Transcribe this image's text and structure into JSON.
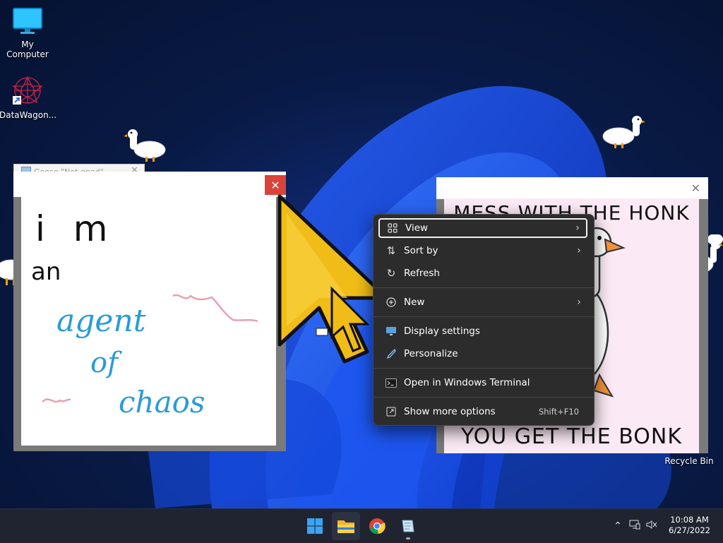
{
  "desktop": {
    "icons": [
      {
        "label": "My Computer",
        "icon": "monitor-icon"
      },
      {
        "label": "DataWagon...",
        "icon": "datawagon-icon"
      },
      {
        "label": "Recycle Bin",
        "icon": "recycle-bin-icon"
      }
    ]
  },
  "notepad_window": {
    "title": "Goose \"Not-epad\"",
    "note_lines": [
      "i m",
      "an",
      "agent",
      "of",
      "chaos"
    ]
  },
  "meme_window": {
    "top_text": "MESS WITH THE HONK",
    "bottom_text": "YOU GET THE BONK"
  },
  "context_menu": {
    "items": [
      {
        "label": "View",
        "icon": "grid-icon",
        "submenu": true
      },
      {
        "label": "Sort by",
        "icon": "sort-icon",
        "submenu": true
      },
      {
        "label": "Refresh",
        "icon": "refresh-icon",
        "submenu": false
      },
      {
        "label": "New",
        "icon": "plus-circle-icon",
        "submenu": true
      },
      {
        "label": "Display settings",
        "icon": "display-icon",
        "submenu": false
      },
      {
        "label": "Personalize",
        "icon": "brush-icon",
        "submenu": false
      },
      {
        "label": "Open in Windows Terminal",
        "icon": "terminal-icon",
        "submenu": false
      },
      {
        "label": "Show more options",
        "icon": "expand-icon",
        "shortcut": "Shift+F10"
      }
    ]
  },
  "taskbar": {
    "apps": [
      {
        "name": "Start",
        "icon": "windows-start-icon"
      },
      {
        "name": "File Explorer",
        "icon": "folder-icon"
      },
      {
        "name": "Google Chrome",
        "icon": "chrome-icon"
      },
      {
        "name": "Goose Notepad",
        "icon": "notepad-icon"
      }
    ],
    "clock": {
      "time": "10:08 AM",
      "date": "6/27/2022"
    }
  }
}
